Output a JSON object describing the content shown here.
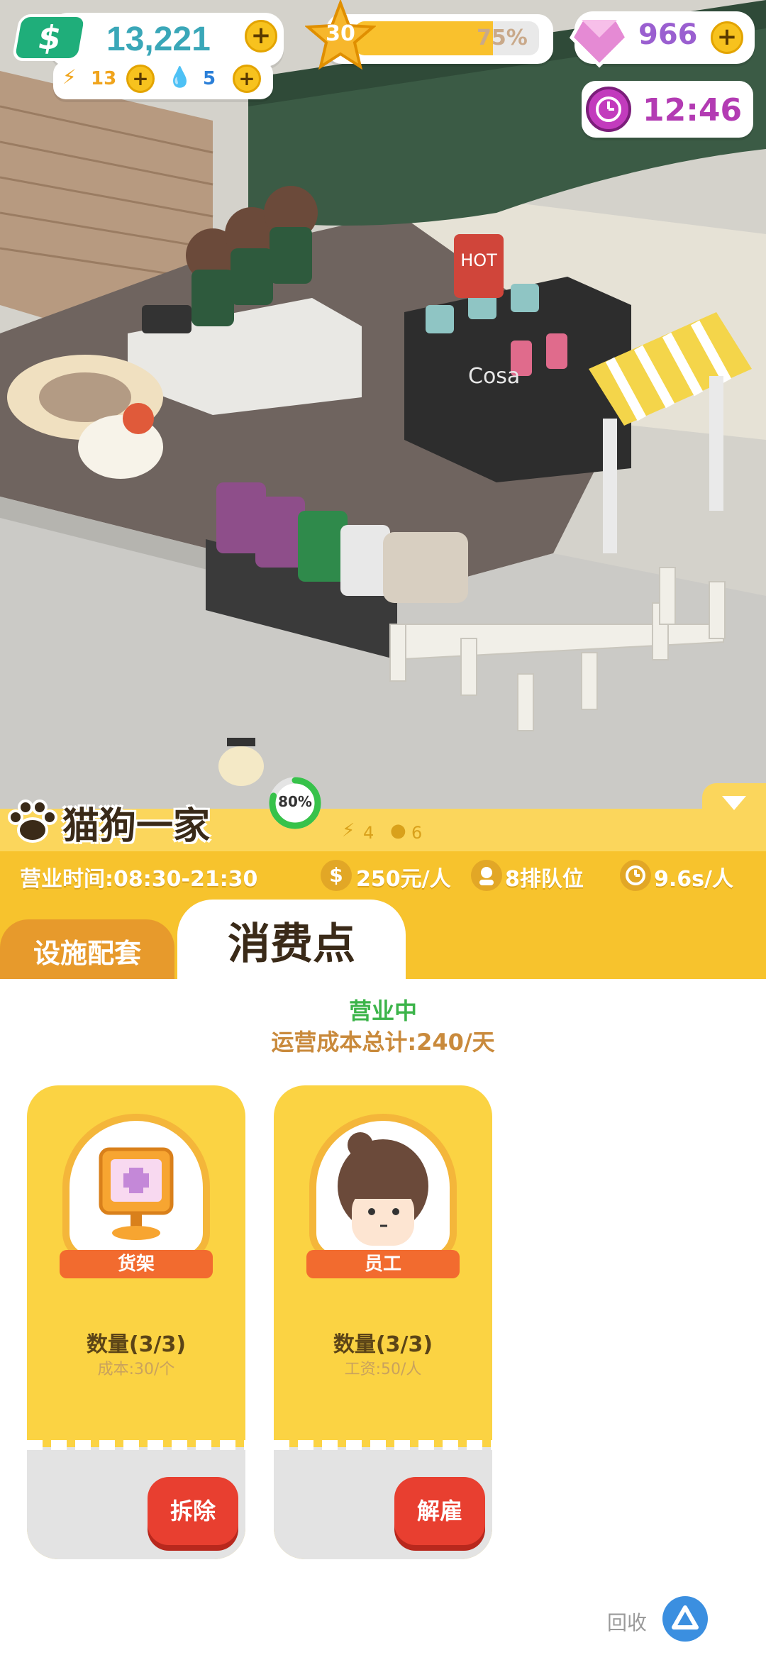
{
  "hud": {
    "money": "13,221",
    "energy": "13",
    "water": "5",
    "level": "30",
    "level_progress": 0.75,
    "level_progress_text": "75%",
    "gems": "966",
    "time": "12:46"
  },
  "shop": {
    "name": "猫狗一家",
    "satisfaction_text": "80%",
    "satisfaction": 0.8,
    "energy_cost": "4",
    "water_cost": "6",
    "hours": "营业时间:08:30-21:30",
    "price": "250元/人",
    "queue": "8排队位",
    "service_time": "9.6s/人"
  },
  "tabs": {
    "facilities": "设施配套",
    "consumption": "消费点"
  },
  "status": {
    "open": "营业中",
    "cost_total": "运营成本总计:240/天"
  },
  "cards": [
    {
      "tag": "货架",
      "qty": "数量(3/3)",
      "sub": "成本:30/个",
      "button": "拆除"
    },
    {
      "tag": "员工",
      "qty": "数量(3/3)",
      "sub": "工资:50/人",
      "button": "解雇"
    }
  ],
  "footer": {
    "recycle": "回收"
  },
  "scene_signs": {
    "cosa": "Cosa",
    "hot": "HOT"
  }
}
